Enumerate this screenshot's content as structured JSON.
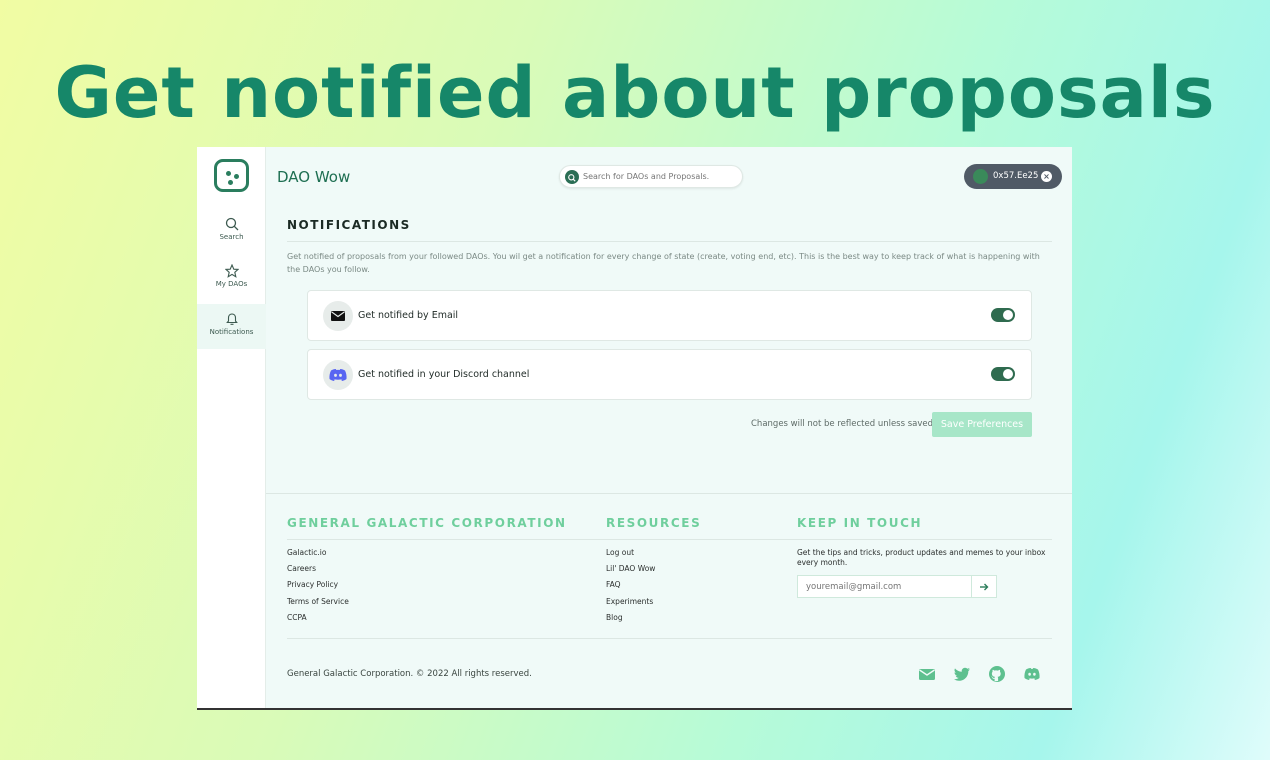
{
  "hero": {
    "title": "Get notified about proposals"
  },
  "app": {
    "name": "DAO Wow",
    "search": {
      "placeholder": "Search for DAOs and Proposals."
    },
    "wallet": {
      "address": "0x57.Ee25"
    },
    "sidebar": {
      "items": [
        {
          "label": "Search",
          "icon": "search-icon"
        },
        {
          "label": "My DAOs",
          "icon": "star-icon"
        },
        {
          "label": "Notifications",
          "icon": "bell-icon",
          "active": true
        }
      ]
    },
    "notifications": {
      "title": "NOTIFICATIONS",
      "description": "Get notified of proposals from your followed DAOs. You wil get a notification for every change of state (create, voting end, etc). This is the best way to keep track of what is happening with the DAOs you follow.",
      "options": [
        {
          "label": "Get notified by Email",
          "icon": "envelope-icon",
          "enabled": true
        },
        {
          "label": "Get notified in your Discord channel",
          "icon": "discord-icon",
          "enabled": true
        }
      ],
      "note": "Changes will not be reflected unless saved",
      "save_label": "Save Preferences"
    },
    "footer": {
      "col1": {
        "heading": "GENERAL GALACTIC CORPORATION",
        "links": [
          "Galactic.io",
          "Careers",
          "Privacy Policy",
          "Terms of Service",
          "CCPA"
        ]
      },
      "col2": {
        "heading": "RESOURCES",
        "links": [
          "Log out",
          "Lil' DAO Wow",
          "FAQ",
          "Experiments",
          "Blog"
        ]
      },
      "col3": {
        "heading": "KEEP IN TOUCH",
        "description": "Get the tips and tricks, product updates and memes to your inbox every month.",
        "email_placeholder": "youremail@gmail.com"
      },
      "copyright": "General Galactic Corporation. © 2022 All rights reserved.",
      "social": [
        "mail-icon",
        "twitter-icon",
        "github-icon",
        "discord-icon"
      ]
    }
  },
  "colors": {
    "brand": "#168769",
    "accent": "#6fcf9d",
    "toggle": "#2f6b4f",
    "save_button": "#a7e6c8"
  }
}
